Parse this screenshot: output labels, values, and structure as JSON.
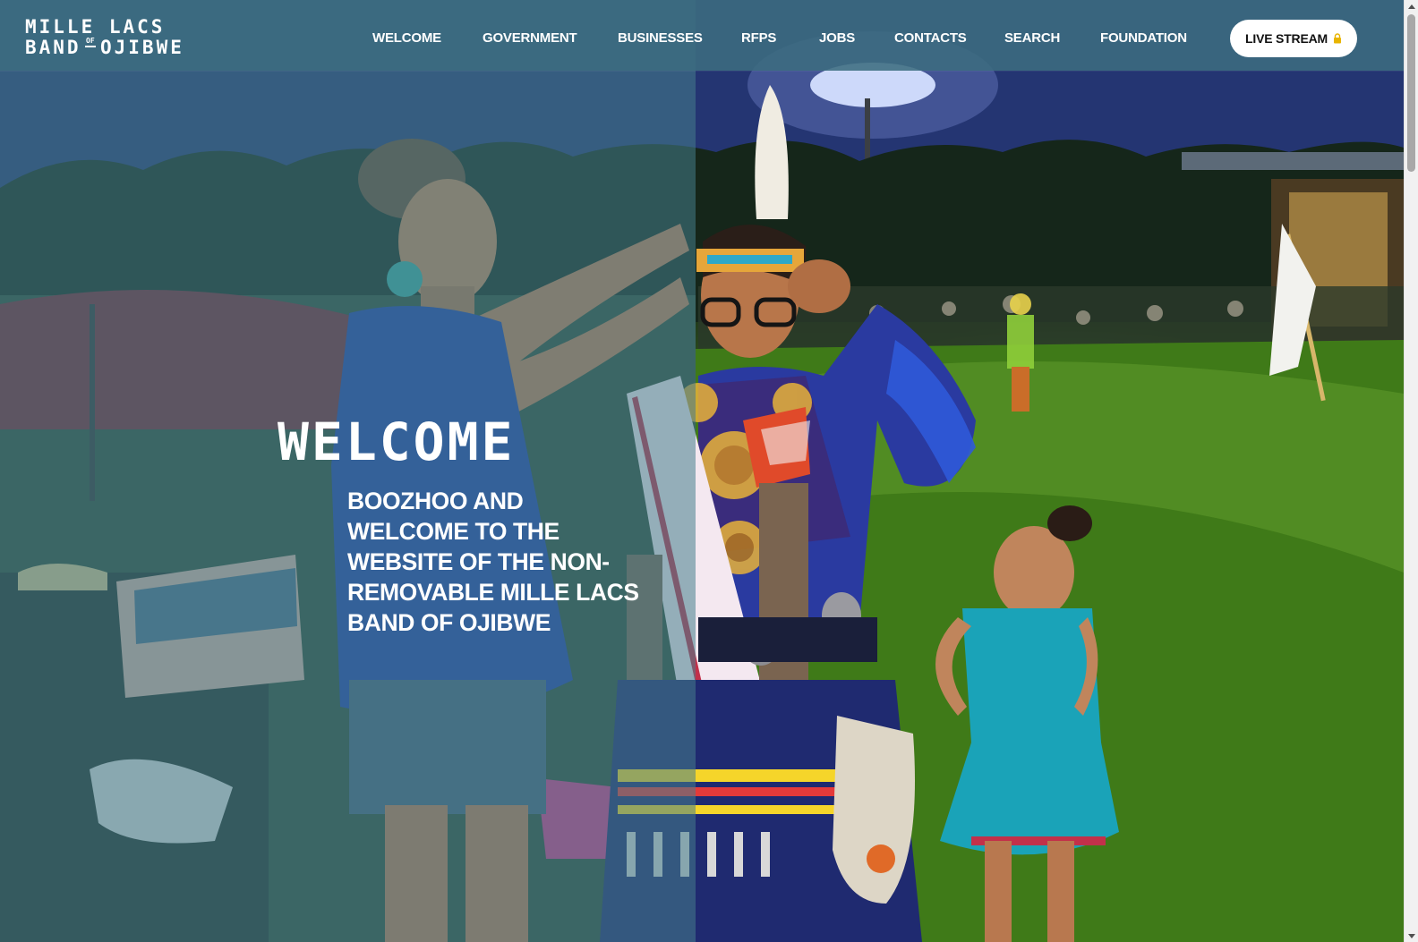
{
  "site": {
    "logo": {
      "line1": "MILLE LACS",
      "line2_left": "BAND",
      "line2_of": "OF",
      "line2_right": "OJIBWE"
    }
  },
  "nav": {
    "items": [
      {
        "label": "WELCOME"
      },
      {
        "label": "GOVERNMENT"
      },
      {
        "label": "BUSINESSES"
      },
      {
        "label": "RFPS"
      },
      {
        "label": "JOBS"
      },
      {
        "label": "CONTACTS"
      },
      {
        "label": "SEARCH"
      },
      {
        "label": "FOUNDATION"
      }
    ],
    "live_stream": {
      "label": "LIVE STREAM",
      "icon": "lock-icon",
      "icon_color": "#e8b400"
    }
  },
  "hero": {
    "title": "WELCOME",
    "subtitle": "BOOZHOO AND WELCOME TO THE WEBSITE OF THE NON-REMOVABLE MILLE LACS BAND OF OJIBWE",
    "overlay_color": "#467d8c"
  },
  "colors": {
    "header_bg": "#3c6c80",
    "button_bg": "#ffffff",
    "text": "#ffffff"
  }
}
